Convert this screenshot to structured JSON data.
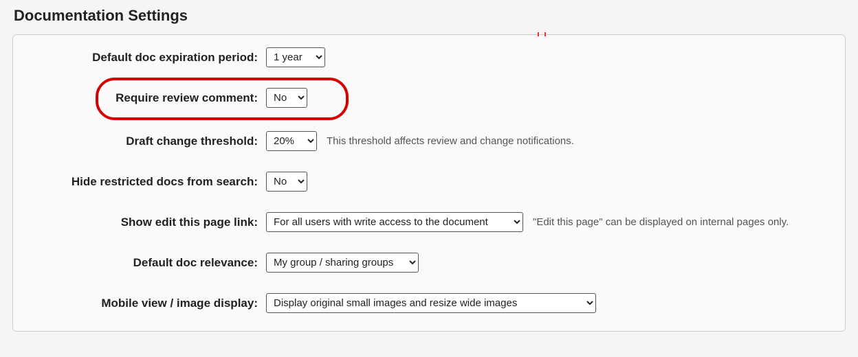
{
  "page": {
    "title": "Documentation Settings"
  },
  "settings": {
    "default_expiration": {
      "label": "Default doc expiration period:",
      "value": "1 year"
    },
    "require_review_comment": {
      "label": "Require review comment:",
      "value": "No"
    },
    "draft_change_threshold": {
      "label": "Draft change threshold:",
      "value": "20%",
      "hint": "This threshold affects review and change notifications."
    },
    "hide_restricted_from_search": {
      "label": "Hide restricted docs from search:",
      "value": "No"
    },
    "show_edit_link": {
      "label": "Show edit this page link:",
      "value": "For all users with write access to the document",
      "hint": "\"Edit this page\" can be displayed on internal pages only."
    },
    "default_relevance": {
      "label": "Default doc relevance:",
      "value": "My group / sharing groups"
    },
    "mobile_image_display": {
      "label": "Mobile view / image display:",
      "value": "Display original small images and resize wide images"
    }
  },
  "highlight": {
    "target": "require_review_comment",
    "color": "#d60000"
  }
}
